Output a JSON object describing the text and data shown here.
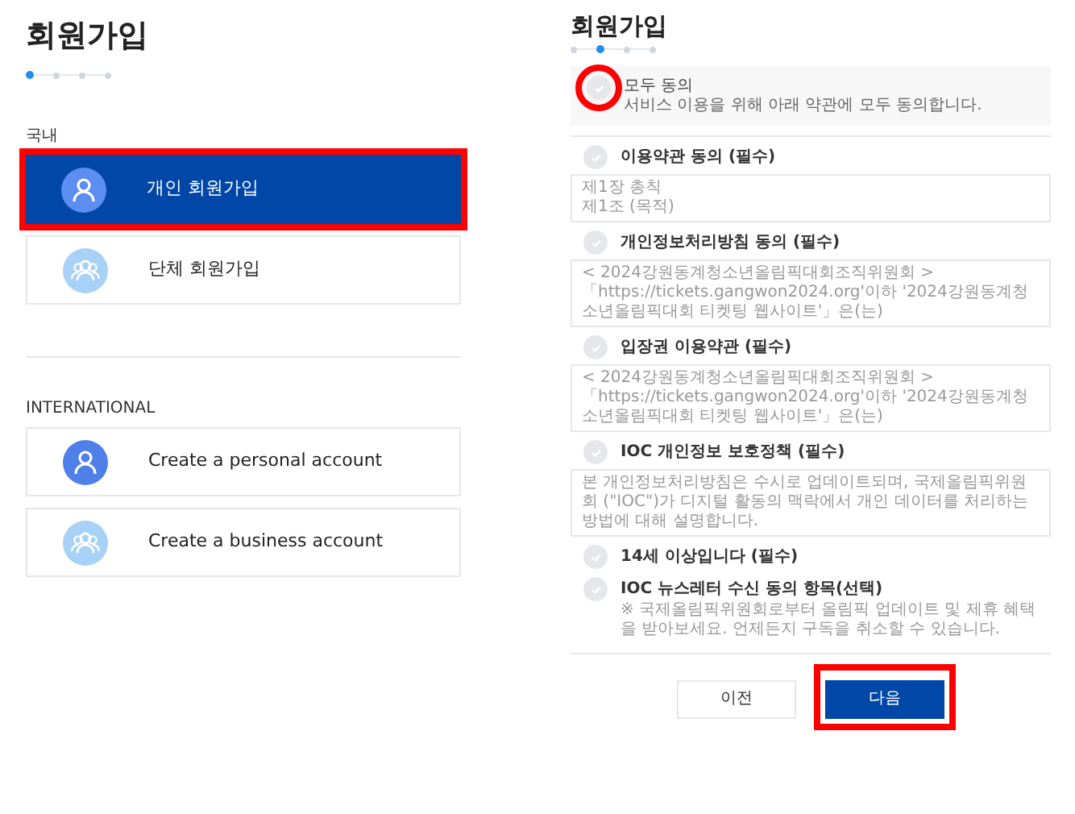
{
  "left": {
    "title": "회원가입",
    "steps": [
      {
        "selected": true
      },
      {
        "selected": false
      },
      {
        "selected": false
      },
      {
        "selected": false
      }
    ],
    "sections": [
      {
        "label": "국내",
        "options": [
          {
            "label": "개인 회원가입",
            "kind": "personal",
            "selected": true,
            "highlighted": true
          },
          {
            "label": "단체 회원가입",
            "kind": "group",
            "selected": false,
            "highlighted": false
          }
        ]
      },
      {
        "label": "INTERNATIONAL",
        "options": [
          {
            "label": "Create a personal account",
            "kind": "personal-blue",
            "selected": false,
            "highlighted": false
          },
          {
            "label": "Create a business account",
            "kind": "group",
            "selected": false,
            "highlighted": false
          }
        ]
      }
    ]
  },
  "right": {
    "title": "회원가입",
    "steps": [
      {
        "selected": false
      },
      {
        "selected": true
      },
      {
        "selected": false
      },
      {
        "selected": false
      }
    ],
    "agree_all": {
      "label": "모두 동의",
      "description": "서비스 이용을 위해 아래 약관에 모두 동의합니다.",
      "checked": false,
      "highlighted": true
    },
    "terms": [
      {
        "label": "이용약관 동의 (필수)",
        "checked": false,
        "kind": "box",
        "lines": [
          "제1장 총칙",
          "제1조 (목적)"
        ]
      },
      {
        "label": "개인정보처리방침 동의 (필수)",
        "checked": false,
        "kind": "box",
        "lines": [
          "< 2024강원동계청소년올림픽대회조직위원회 >",
          "「https://tickets.gangwon2024.org'이하 '2024강원동계청소년올림픽대회 티켓팅 웹사이트'」은(는)"
        ]
      },
      {
        "label": "입장권 이용약관 (필수)",
        "checked": false,
        "kind": "box",
        "lines": [
          "< 2024강원동계청소년올림픽대회조직위원회 >",
          "「https://tickets.gangwon2024.org'이하 '2024강원동계청소년올림픽대회 티켓팅 웹사이트'」은(는)"
        ]
      },
      {
        "label": "IOC 개인정보 보호정책 (필수)",
        "checked": false,
        "kind": "box",
        "lines": [
          "본 개인정보처리방침은 수시로 업데이트되며, 국제올림픽위원회 (\"IOC\")가 디지털 활동의 맥락에서 개인 데이터를 처리하는 방법에 대해 설명합니다."
        ]
      },
      {
        "label": "14세 이상입니다 (필수)",
        "checked": false,
        "kind": "plain"
      },
      {
        "label": "IOC 뉴스레터 수신 동의 항목(선택)",
        "checked": false,
        "kind": "note",
        "lines": [
          "※ 국제올림픽위원회로부터 올림픽 업데이트 및 제휴 혜택을 받아보세요. 언제든지 구독을 취소할 수 있습니다."
        ]
      }
    ],
    "buttons": [
      {
        "label": "이전",
        "kind": "secondary",
        "highlighted": false
      },
      {
        "label": "다음",
        "kind": "primary",
        "highlighted": true
      }
    ]
  }
}
